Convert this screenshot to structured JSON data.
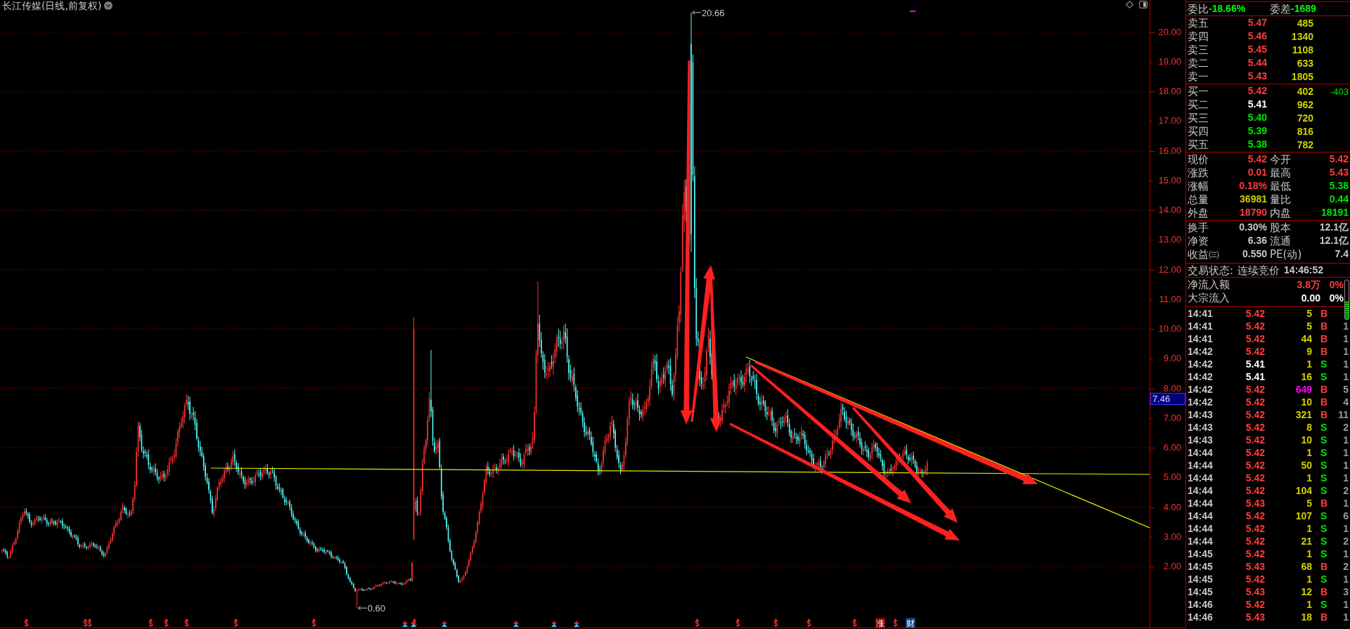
{
  "chart": {
    "title": "长江传媒(日线,前复权)",
    "high_label": "20.66",
    "low_label": "0.60",
    "y_axis_labels": [
      "20.00",
      "19.00",
      "18.00",
      "17.00",
      "16.00",
      "15.00",
      "14.00",
      "13.00",
      "12.00",
      "11.00",
      "10.00",
      "9.00",
      "8.00",
      "7.00",
      "6.00",
      "5.00",
      "4.00",
      "3.00",
      "2.00"
    ],
    "cursor_price": "7.46",
    "event_tags": [
      {
        "text": "涨",
        "color": "#800000"
      },
      {
        "text": "财",
        "color": "#103c78"
      }
    ]
  },
  "quote_panel": {
    "order_ratio": [
      {
        "label": "委比",
        "value": "-18.66%"
      },
      {
        "label": "委差",
        "value": "-1689"
      }
    ],
    "asks": [
      {
        "label": "卖五",
        "price": "5.47",
        "color": "#ff3c3c",
        "volume": "485"
      },
      {
        "label": "卖四",
        "price": "5.46",
        "color": "#ff3c3c",
        "volume": "1340"
      },
      {
        "label": "卖三",
        "price": "5.45",
        "color": "#ff3c3c",
        "volume": "1108"
      },
      {
        "label": "卖二",
        "price": "5.44",
        "color": "#ff3c3c",
        "volume": "633"
      },
      {
        "label": "卖一",
        "price": "5.43",
        "color": "#ff3c3c",
        "volume": "1805"
      }
    ],
    "bids": [
      {
        "label": "买一",
        "price": "5.42",
        "color": "#ff3c3c",
        "volume": "402",
        "change": "-403"
      },
      {
        "label": "买二",
        "price": "5.41",
        "color": "#ffffff",
        "volume": "962"
      },
      {
        "label": "买三",
        "price": "5.40",
        "color": "#00e600",
        "volume": "720"
      },
      {
        "label": "买四",
        "price": "5.39",
        "color": "#00e600",
        "volume": "816"
      },
      {
        "label": "买五",
        "price": "5.38",
        "color": "#00e600",
        "volume": "782"
      }
    ],
    "stats": [
      [
        {
          "label": "现价",
          "value": "5.42",
          "color": "#ff3c3c"
        },
        {
          "label": "今开",
          "value": "5.42",
          "color": "#ff3c3c"
        }
      ],
      [
        {
          "label": "涨跌",
          "value": "0.01",
          "color": "#ff3c3c"
        },
        {
          "label": "最高",
          "value": "5.43",
          "color": "#ff3c3c"
        }
      ],
      [
        {
          "label": "涨幅",
          "value": "0.18%",
          "color": "#ff3c3c"
        },
        {
          "label": "最低",
          "value": "5.38",
          "color": "#00e600"
        }
      ],
      [
        {
          "label": "总量",
          "value": "36981",
          "color": "#d2d200"
        },
        {
          "label": "量比",
          "value": "0.44",
          "color": "#00e600"
        }
      ],
      [
        {
          "label": "外盘",
          "value": "18790",
          "color": "#ff3c3c"
        },
        {
          "label": "内盘",
          "value": "18191",
          "color": "#00e600"
        }
      ]
    ],
    "fundamentals": [
      [
        {
          "label": "换手",
          "value": "0.30%"
        },
        {
          "label": "股本",
          "value": "12.1亿"
        }
      ],
      [
        {
          "label": "净资",
          "value": "6.36"
        },
        {
          "label": "流通",
          "value": "12.1亿"
        }
      ],
      [
        {
          "label": "收益㈢",
          "value": "0.550"
        },
        {
          "label": "PE(动)",
          "value": "7.4"
        }
      ]
    ],
    "trade_status": {
      "label": "交易状态:",
      "status": "连续竞价",
      "time": "14:46:52"
    },
    "flows": [
      {
        "label": "净流入额",
        "value": "3.8万",
        "percent": "0%",
        "color": "#ff3c3c"
      },
      {
        "label": "大宗流入",
        "value": "0.00",
        "percent": "0%",
        "color": "#ffffff"
      }
    ],
    "flow_meter": {
      "level": 0.45
    },
    "ticks": [
      {
        "time": "14:41",
        "price": "5.42",
        "color": "#ff3c3c",
        "volume": "5",
        "large": false,
        "side": "B",
        "kind": "buy"
      },
      {
        "time": "14:41",
        "price": "5.42",
        "color": "#ff3c3c",
        "volume": "5",
        "large": false,
        "side": "B",
        "kind": "buy",
        "count": "1"
      },
      {
        "time": "14:41",
        "price": "5.42",
        "color": "#ff3c3c",
        "volume": "44",
        "large": false,
        "side": "B",
        "kind": "buy",
        "count": "1"
      },
      {
        "time": "14:42",
        "price": "5.42",
        "color": "#ff3c3c",
        "volume": "9",
        "large": false,
        "side": "B",
        "kind": "buy",
        "count": "1"
      },
      {
        "time": "14:42",
        "price": "5.41",
        "color": "#ffffff",
        "volume": "1",
        "large": false,
        "side": "S",
        "kind": "sell",
        "count": "1"
      },
      {
        "time": "14:42",
        "price": "5.41",
        "color": "#ffffff",
        "volume": "16",
        "large": false,
        "side": "S",
        "kind": "sell",
        "count": "1"
      },
      {
        "time": "14:42",
        "price": "5.42",
        "color": "#ff3c3c",
        "volume": "649",
        "large": true,
        "side": "B",
        "kind": "buy",
        "count": "5"
      },
      {
        "time": "14:42",
        "price": "5.42",
        "color": "#ff3c3c",
        "volume": "10",
        "large": false,
        "side": "B",
        "kind": "buy",
        "count": "4"
      },
      {
        "time": "14:43",
        "price": "5.42",
        "color": "#ff3c3c",
        "volume": "321",
        "large": false,
        "side": "B",
        "kind": "buy",
        "count": "11"
      },
      {
        "time": "14:43",
        "price": "5.42",
        "color": "#ff3c3c",
        "volume": "8",
        "large": false,
        "side": "S",
        "kind": "sell",
        "count": "2"
      },
      {
        "time": "14:43",
        "price": "5.42",
        "color": "#ff3c3c",
        "volume": "10",
        "large": false,
        "side": "S",
        "kind": "sell",
        "count": "1"
      },
      {
        "time": "14:44",
        "price": "5.42",
        "color": "#ff3c3c",
        "volume": "1",
        "large": false,
        "side": "S",
        "kind": "sell",
        "count": "1"
      },
      {
        "time": "14:44",
        "price": "5.42",
        "color": "#ff3c3c",
        "volume": "50",
        "large": false,
        "side": "S",
        "kind": "sell",
        "count": "1"
      },
      {
        "time": "14:44",
        "price": "5.42",
        "color": "#ff3c3c",
        "volume": "1",
        "large": false,
        "side": "S",
        "kind": "sell",
        "count": "1"
      },
      {
        "time": "14:44",
        "price": "5.42",
        "color": "#ff3c3c",
        "volume": "104",
        "large": false,
        "side": "S",
        "kind": "sell",
        "count": "2"
      },
      {
        "time": "14:44",
        "price": "5.43",
        "color": "#ff3c3c",
        "volume": "5",
        "large": false,
        "side": "B",
        "kind": "buy",
        "count": "1"
      },
      {
        "time": "14:44",
        "price": "5.42",
        "color": "#ff3c3c",
        "volume": "107",
        "large": false,
        "side": "S",
        "kind": "sell",
        "count": "6"
      },
      {
        "time": "14:44",
        "price": "5.42",
        "color": "#ff3c3c",
        "volume": "1",
        "large": false,
        "side": "S",
        "kind": "sell",
        "count": "1"
      },
      {
        "time": "14:44",
        "price": "5.42",
        "color": "#ff3c3c",
        "volume": "21",
        "large": false,
        "side": "S",
        "kind": "sell",
        "count": "2"
      },
      {
        "time": "14:45",
        "price": "5.42",
        "color": "#ff3c3c",
        "volume": "1",
        "large": false,
        "side": "S",
        "kind": "sell",
        "count": "1"
      },
      {
        "time": "14:45",
        "price": "5.43",
        "color": "#ff3c3c",
        "volume": "68",
        "large": false,
        "side": "B",
        "kind": "buy",
        "count": "2"
      },
      {
        "time": "14:45",
        "price": "5.42",
        "color": "#ff3c3c",
        "volume": "1",
        "large": false,
        "side": "S",
        "kind": "sell",
        "count": "1"
      },
      {
        "time": "14:45",
        "price": "5.43",
        "color": "#ff3c3c",
        "volume": "12",
        "large": false,
        "side": "B",
        "kind": "buy",
        "count": "3"
      },
      {
        "time": "14:46",
        "price": "5.42",
        "color": "#ff3c3c",
        "volume": "1",
        "large": false,
        "side": "S",
        "kind": "sell",
        "count": "1"
      },
      {
        "time": "14:46",
        "price": "5.43",
        "color": "#ff3c3c",
        "volume": "18",
        "large": false,
        "side": "B",
        "kind": "buy",
        "count": "1"
      }
    ]
  }
}
